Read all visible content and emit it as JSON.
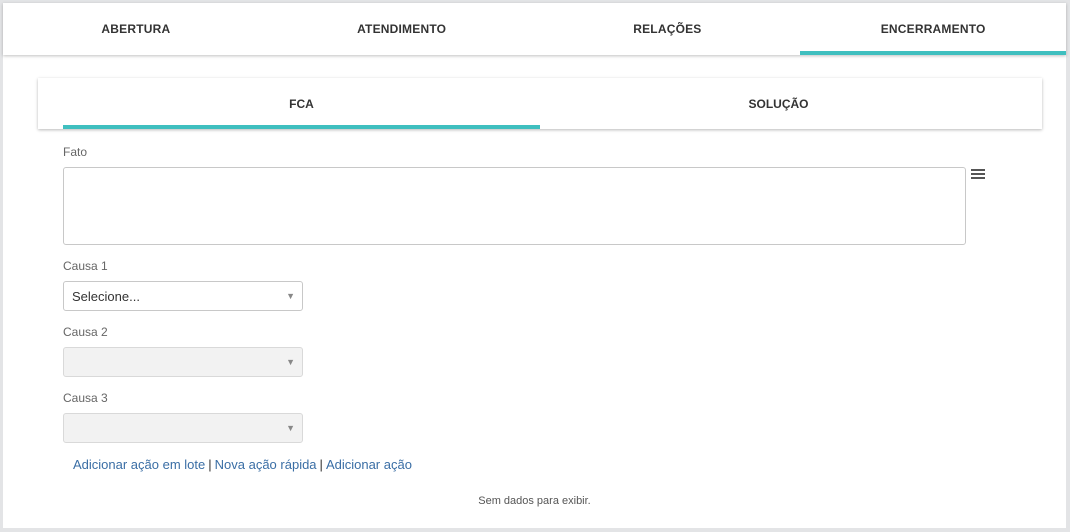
{
  "main_tabs": [
    {
      "label": "ABERTURA",
      "active": false
    },
    {
      "label": "ATENDIMENTO",
      "active": false
    },
    {
      "label": "RELAÇÕES",
      "active": false
    },
    {
      "label": "ENCERRAMENTO",
      "active": true
    }
  ],
  "sub_tabs": [
    {
      "label": "FCA",
      "active": true
    },
    {
      "label": "SOLUÇÃO",
      "active": false
    }
  ],
  "form": {
    "fato_label": "Fato",
    "fato_value": "",
    "causa1_label": "Causa 1",
    "causa1_value": "Selecione...",
    "causa2_label": "Causa 2",
    "causa2_value": "",
    "causa3_label": "Causa 3",
    "causa3_value": ""
  },
  "actions": {
    "batch": "Adicionar ação em lote",
    "quick": "Nova ação rápida",
    "add": "Adicionar ação",
    "separator": "|"
  },
  "empty_message": "Sem dados para exibir.",
  "icons": {
    "fato_menu": "hamburger-menu-icon",
    "select_arrow": "caret-down-icon"
  },
  "colors": {
    "accent": "#3fbfbf",
    "link": "#3a6ea5"
  }
}
